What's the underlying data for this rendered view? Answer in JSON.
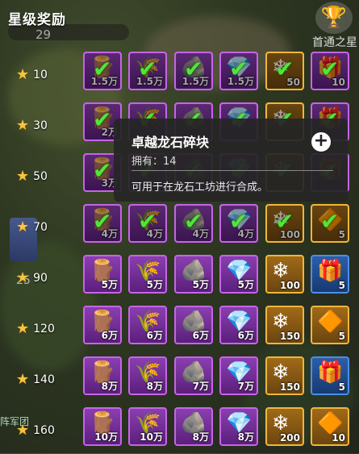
{
  "header": {
    "title": "星级奖励",
    "progress_num": "29",
    "right_label": "首通之星"
  },
  "map": {
    "left_label": "阵军团",
    "rank_num": "25"
  },
  "icons": {
    "wood": "🪵",
    "wheat": "🌾",
    "stone": "🪨",
    "crystal": "💎",
    "ice": "❄",
    "chest": "🎁",
    "amber": "🔶",
    "check": "✔"
  },
  "rows": [
    {
      "stars": "10",
      "claimed": true,
      "items": [
        {
          "type": "wood",
          "amount": "1.5万",
          "style": "purple"
        },
        {
          "type": "wheat",
          "amount": "1.5万",
          "style": "purple"
        },
        {
          "type": "stone",
          "amount": "1.5万",
          "style": "purple"
        },
        {
          "type": "crystal",
          "amount": "1.5万",
          "style": "purple"
        },
        {
          "type": "ice",
          "amount": "50",
          "style": "gold"
        },
        {
          "type": "chest",
          "amount": "10",
          "style": "purple"
        }
      ]
    },
    {
      "stars": "30",
      "claimed": true,
      "items": [
        {
          "type": "wood",
          "amount": "2万",
          "style": "purple"
        },
        {
          "type": "wheat",
          "amount": "",
          "style": "purple"
        },
        {
          "type": "stone",
          "amount": "",
          "style": "purple"
        },
        {
          "type": "crystal",
          "amount": "",
          "style": "purple"
        },
        {
          "type": "ice",
          "amount": "",
          "style": "gold"
        },
        {
          "type": "chest",
          "amount": "",
          "style": "purple"
        }
      ]
    },
    {
      "stars": "50",
      "claimed": true,
      "items": [
        {
          "type": "wood",
          "amount": "3万",
          "style": "purple"
        },
        {
          "type": "wheat",
          "amount": "",
          "style": "purple"
        },
        {
          "type": "stone",
          "amount": "",
          "style": "purple"
        },
        {
          "type": "crystal",
          "amount": "",
          "style": "purple"
        },
        {
          "type": "ice",
          "amount": "",
          "style": "gold"
        },
        {
          "type": "chest",
          "amount": "",
          "style": "purple"
        }
      ]
    },
    {
      "stars": "70",
      "claimed": true,
      "items": [
        {
          "type": "wood",
          "amount": "4万",
          "style": "purple"
        },
        {
          "type": "wheat",
          "amount": "4万",
          "style": "purple"
        },
        {
          "type": "stone",
          "amount": "4万",
          "style": "purple"
        },
        {
          "type": "crystal",
          "amount": "4万",
          "style": "purple"
        },
        {
          "type": "ice",
          "amount": "100",
          "style": "gold"
        },
        {
          "type": "amber",
          "amount": "5",
          "style": "gold"
        }
      ]
    },
    {
      "stars": "90",
      "claimed": false,
      "items": [
        {
          "type": "wood",
          "amount": "5万",
          "style": "purple"
        },
        {
          "type": "wheat",
          "amount": "5万",
          "style": "purple"
        },
        {
          "type": "stone",
          "amount": "5万",
          "style": "purple"
        },
        {
          "type": "crystal",
          "amount": "5万",
          "style": "purple"
        },
        {
          "type": "ice",
          "amount": "100",
          "style": "gold"
        },
        {
          "type": "chest",
          "amount": "5",
          "style": "blue"
        }
      ]
    },
    {
      "stars": "120",
      "claimed": false,
      "items": [
        {
          "type": "wood",
          "amount": "6万",
          "style": "purple"
        },
        {
          "type": "wheat",
          "amount": "6万",
          "style": "purple"
        },
        {
          "type": "stone",
          "amount": "6万",
          "style": "purple"
        },
        {
          "type": "crystal",
          "amount": "6万",
          "style": "purple"
        },
        {
          "type": "ice",
          "amount": "150",
          "style": "gold"
        },
        {
          "type": "amber",
          "amount": "5",
          "style": "gold"
        }
      ]
    },
    {
      "stars": "140",
      "claimed": false,
      "items": [
        {
          "type": "wood",
          "amount": "8万",
          "style": "purple"
        },
        {
          "type": "wheat",
          "amount": "8万",
          "style": "purple"
        },
        {
          "type": "stone",
          "amount": "7万",
          "style": "purple"
        },
        {
          "type": "crystal",
          "amount": "7万",
          "style": "purple"
        },
        {
          "type": "ice",
          "amount": "150",
          "style": "gold"
        },
        {
          "type": "chest",
          "amount": "5",
          "style": "blue"
        }
      ]
    },
    {
      "stars": "160",
      "claimed": false,
      "items": [
        {
          "type": "wood",
          "amount": "10万",
          "style": "purple"
        },
        {
          "type": "wheat",
          "amount": "10万",
          "style": "purple"
        },
        {
          "type": "stone",
          "amount": "8万",
          "style": "purple"
        },
        {
          "type": "crystal",
          "amount": "8万",
          "style": "purple"
        },
        {
          "type": "ice",
          "amount": "200",
          "style": "gold"
        },
        {
          "type": "amber",
          "amount": "10",
          "style": "gold"
        }
      ]
    }
  ],
  "tooltip": {
    "title": "卓越龙石碎块",
    "owned": "拥有：14",
    "description": "可用于在龙石工坊进行合成。",
    "plus": "+"
  }
}
